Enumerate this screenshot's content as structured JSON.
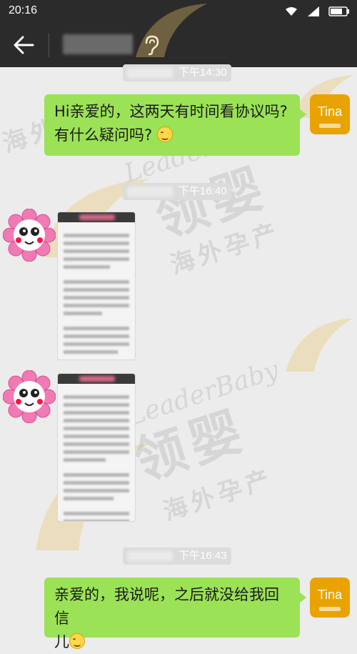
{
  "status_bar": {
    "time": "20:16",
    "icons": [
      "wifi-icon",
      "signal-icon",
      "battery-icon"
    ]
  },
  "header": {
    "back_icon": "arrow-left-icon",
    "contact_name": "",
    "voice_icon": "ear-icon"
  },
  "watermark": {
    "latin": "LeaderBaby",
    "chinese": "领婴",
    "subtitle": "海外孕产"
  },
  "messages": [
    {
      "type": "timestamp",
      "time": "下午14:30"
    },
    {
      "type": "text",
      "sender": "me",
      "avatar_label": "Tina",
      "lines": [
        "Hi亲爱的，这两天有时间看协议吗?",
        "有什么疑问吗?"
      ],
      "emoji": "smile-emoji-icon"
    },
    {
      "type": "timestamp",
      "time": "下午16:40"
    },
    {
      "type": "image",
      "sender": "other",
      "avatar": "flower-avatar-icon"
    },
    {
      "type": "image",
      "sender": "other",
      "avatar": "flower-avatar-icon"
    },
    {
      "type": "timestamp",
      "time": "下午16:43"
    },
    {
      "type": "text",
      "sender": "me",
      "avatar_label": "Tina",
      "lines": [
        "亲爱的，我说呢，之后就没给我回信",
        "儿"
      ],
      "emoji": "smile-emoji-icon"
    }
  ],
  "colors": {
    "bar": "#2b2b2b",
    "bubble_out": "#9be256",
    "tina_avatar": "#e9a300",
    "background": "#ececec"
  }
}
